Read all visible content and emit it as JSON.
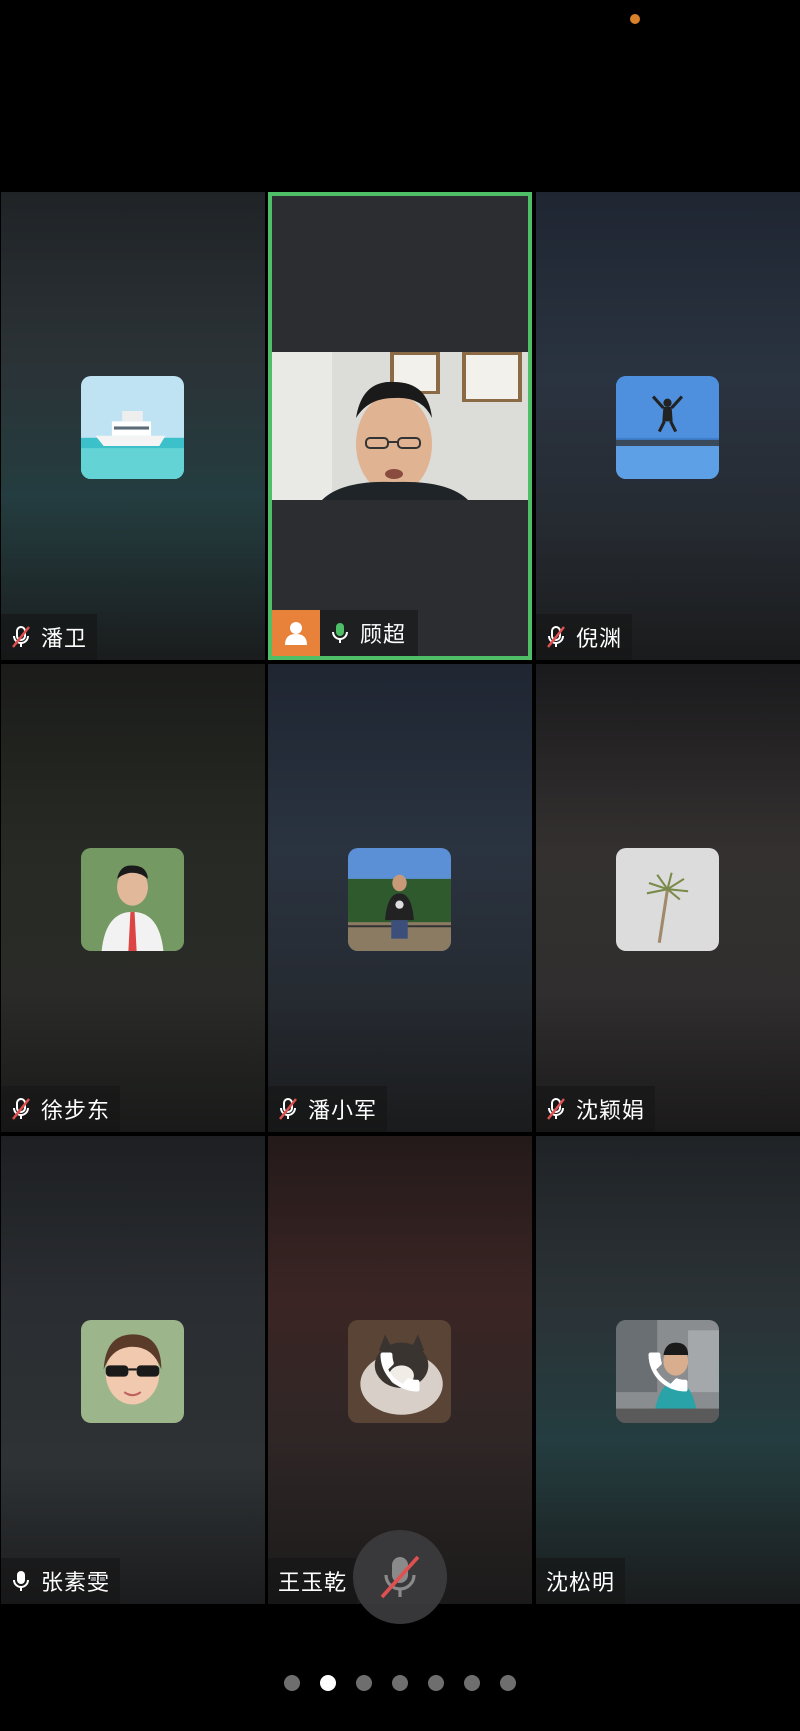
{
  "status": {
    "indicator_color": "#d9822b"
  },
  "participants": [
    {
      "name": "潘卫",
      "mic": "muted"
    },
    {
      "name": "顾超",
      "mic": "on",
      "speaking": true,
      "host": true
    },
    {
      "name": "倪渊",
      "mic": "muted"
    },
    {
      "name": "徐步东",
      "mic": "muted"
    },
    {
      "name": "潘小军",
      "mic": "muted"
    },
    {
      "name": "沈颖娟",
      "mic": "muted"
    },
    {
      "name": "张素雯",
      "mic": "on"
    },
    {
      "name": "王玉乾",
      "mic": "none",
      "state": "calling"
    },
    {
      "name": "沈松明",
      "mic": "none",
      "state": "calling"
    }
  ],
  "controls": {
    "mute_button_icon": "mic-muted-icon"
  },
  "pager": {
    "count": 7,
    "current": 1
  },
  "colors": {
    "active_border": "#4fbf67",
    "host_badge": "#e8823b",
    "muted_slash": "#e05050"
  }
}
